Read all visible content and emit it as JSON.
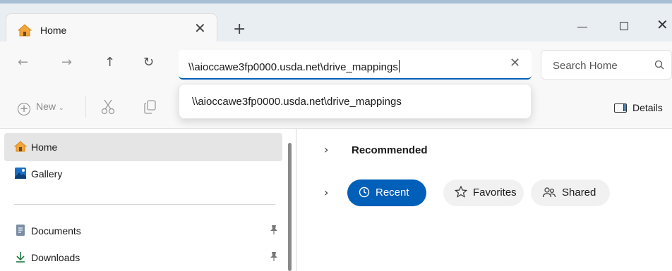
{
  "tab": {
    "title": "Home",
    "close_glyph": "✕",
    "new_tab_glyph": "+",
    "icon": "home-icon"
  },
  "window_controls": {
    "close_glyph": "✕"
  },
  "navigation": {
    "back_glyph": "←",
    "forward_glyph": "→",
    "up_glyph": "↑",
    "refresh_glyph": "↻"
  },
  "address_bar": {
    "value": "\\\\aioccawe3fp0000.usda.net\\drive_mappings",
    "clear_glyph": "✕",
    "focus_color": "#005fb8"
  },
  "search": {
    "placeholder": "Search Home",
    "icon": "search-icon"
  },
  "toolbar": {
    "new_label": "New",
    "new_glyph": "+",
    "chevron_glyph": "⌄",
    "details_label": "Details"
  },
  "suggestions": [
    {
      "label": "\\\\aioccawe3fp0000.usda.net\\drive_mappings"
    }
  ],
  "sidebar": {
    "items": [
      {
        "label": "Home",
        "icon": "home-icon",
        "selected": true
      },
      {
        "label": "Gallery",
        "icon": "gallery-icon",
        "selected": false
      },
      {
        "label": "Documents",
        "icon": "documents-icon",
        "pinned": true
      },
      {
        "label": "Downloads",
        "icon": "download-icon",
        "pinned": true
      }
    ]
  },
  "content": {
    "section_title": "Recommended",
    "expander_glyph": "›",
    "filters": [
      {
        "label": "Recent",
        "icon": "clock-icon",
        "active": true
      },
      {
        "label": "Favorites",
        "icon": "star-icon",
        "active": false
      },
      {
        "label": "Shared",
        "icon": "people-icon",
        "active": false
      }
    ]
  },
  "colors": {
    "accent": "#005fb8",
    "titlebar": "#e9eef3",
    "selected_item": "#e5e5e5"
  }
}
